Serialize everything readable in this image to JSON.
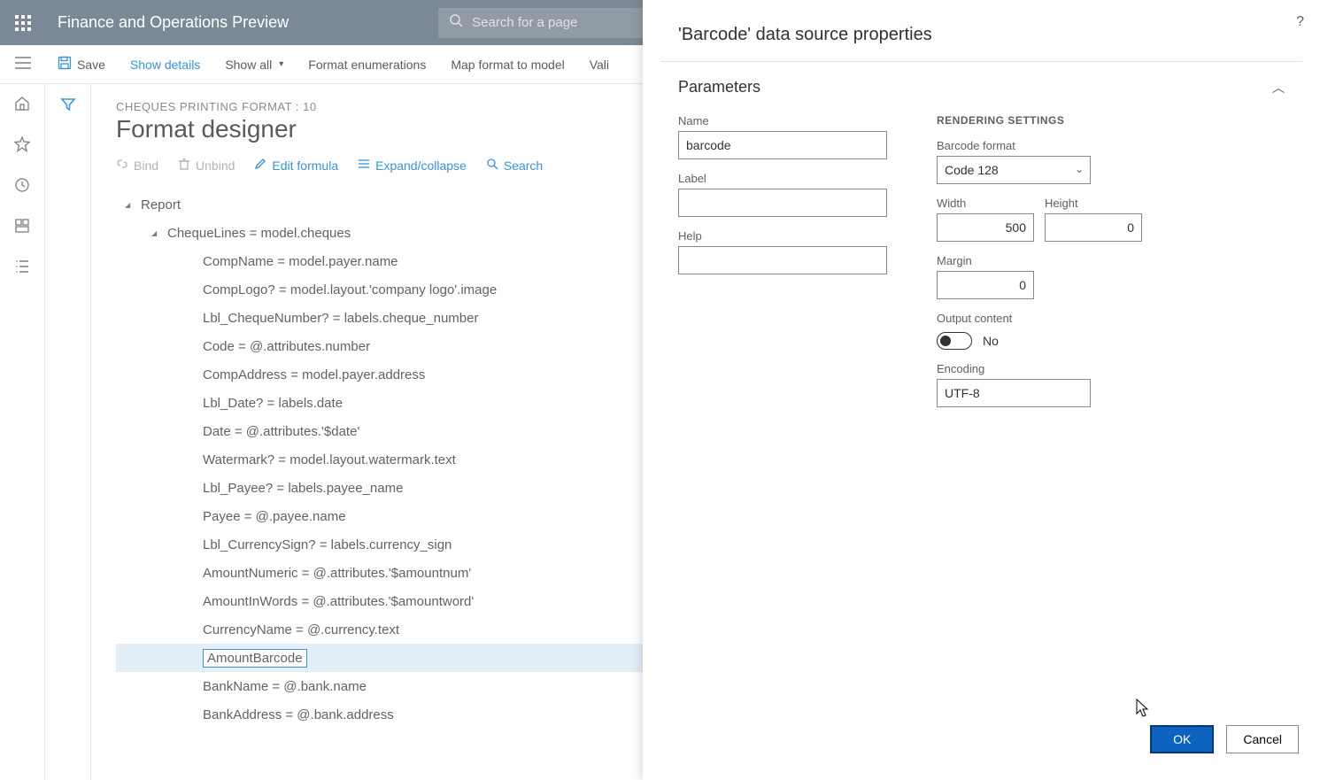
{
  "header": {
    "app_title": "Finance and Operations Preview",
    "search_placeholder": "Search for a page"
  },
  "actionbar": {
    "save": "Save",
    "show_details": "Show details",
    "show_all": "Show all",
    "format_enum": "Format enumerations",
    "map_format": "Map format to model",
    "validate": "Vali"
  },
  "page": {
    "crumb": "CHEQUES PRINTING FORMAT : 10",
    "title": "Format designer"
  },
  "toolbar": {
    "bind": "Bind",
    "unbind": "Unbind",
    "edit_formula": "Edit formula",
    "expand": "Expand/collapse",
    "search": "Search"
  },
  "tree": [
    {
      "indent": 0,
      "caret": true,
      "text": "Report"
    },
    {
      "indent": 1,
      "caret": true,
      "text": "ChequeLines = model.cheques"
    },
    {
      "indent": 2,
      "caret": false,
      "text": "CompName = model.payer.name"
    },
    {
      "indent": 2,
      "caret": false,
      "text": "CompLogo? = model.layout.'company logo'.image"
    },
    {
      "indent": 2,
      "caret": false,
      "text": "Lbl_ChequeNumber? = labels.cheque_number"
    },
    {
      "indent": 2,
      "caret": false,
      "text": "Code = @.attributes.number"
    },
    {
      "indent": 2,
      "caret": false,
      "text": "CompAddress = model.payer.address"
    },
    {
      "indent": 2,
      "caret": false,
      "text": "Lbl_Date? = labels.date"
    },
    {
      "indent": 2,
      "caret": false,
      "text": "Date = @.attributes.'$date'"
    },
    {
      "indent": 2,
      "caret": false,
      "text": "Watermark? = model.layout.watermark.text"
    },
    {
      "indent": 2,
      "caret": false,
      "text": "Lbl_Payee? = labels.payee_name"
    },
    {
      "indent": 2,
      "caret": false,
      "text": "Payee = @.payee.name"
    },
    {
      "indent": 2,
      "caret": false,
      "text": "Lbl_CurrencySign? = labels.currency_sign"
    },
    {
      "indent": 2,
      "caret": false,
      "text": "AmountNumeric = @.attributes.'$amountnum'"
    },
    {
      "indent": 2,
      "caret": false,
      "text": "AmountInWords = @.attributes.'$amountword'"
    },
    {
      "indent": 2,
      "caret": false,
      "text": "CurrencyName = @.currency.text"
    },
    {
      "indent": 2,
      "caret": false,
      "text": "AmountBarcode",
      "selected": true
    },
    {
      "indent": 2,
      "caret": false,
      "text": "BankName = @.bank.name"
    },
    {
      "indent": 2,
      "caret": false,
      "text": "BankAddress = @.bank.address"
    }
  ],
  "panel": {
    "title": "'Barcode' data source properties",
    "section": "Parameters",
    "name_label": "Name",
    "name_value": "barcode",
    "label_label": "Label",
    "label_value": "",
    "help_label": "Help",
    "help_value": "",
    "render_heading": "RENDERING SETTINGS",
    "format_label": "Barcode format",
    "format_value": "Code 128",
    "width_label": "Width",
    "width_value": "500",
    "height_label": "Height",
    "height_value": "0",
    "margin_label": "Margin",
    "margin_value": "0",
    "output_label": "Output content",
    "output_value": "No",
    "encoding_label": "Encoding",
    "encoding_value": "UTF-8",
    "ok": "OK",
    "cancel": "Cancel"
  }
}
